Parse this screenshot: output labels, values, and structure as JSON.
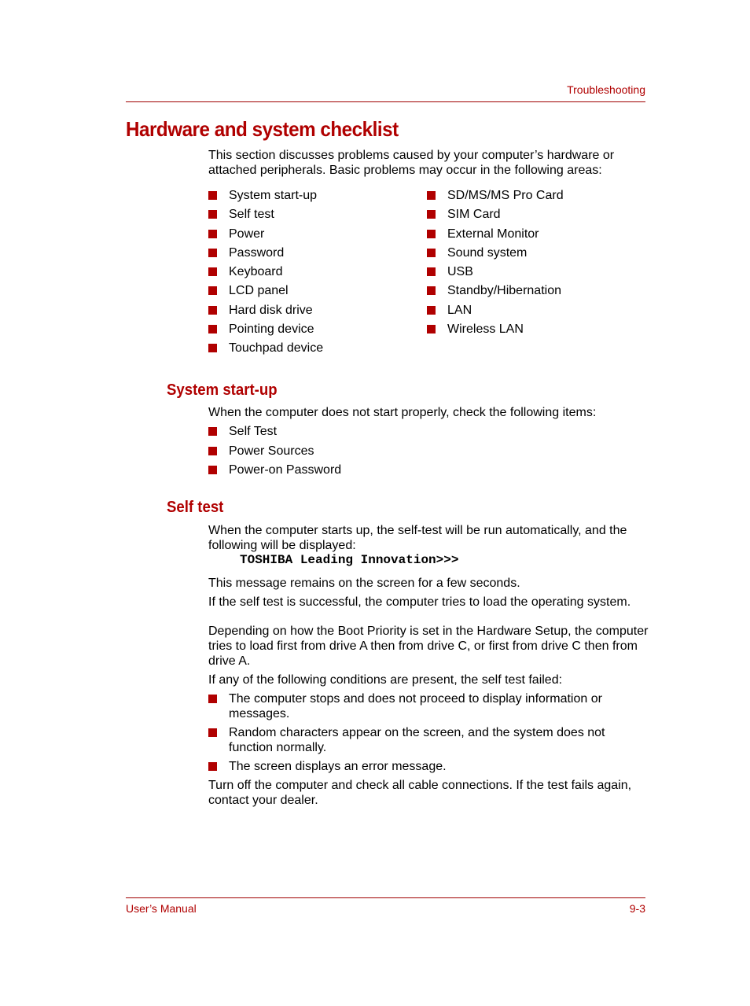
{
  "header": {
    "section": "Troubleshooting"
  },
  "title": "Hardware and system checklist",
  "intro": "This section discusses problems caused by your computer’s hardware or attached peripherals. Basic problems may occur in the following areas:",
  "areas": {
    "left": [
      "System start-up",
      "Self test",
      "Power",
      "Password",
      "Keyboard",
      "LCD panel",
      "Hard disk drive",
      "Pointing device",
      "Touchpad device"
    ],
    "right": [
      "SD/MS/MS Pro Card",
      "SIM Card",
      "External Monitor",
      "Sound system",
      "USB",
      "Standby/Hibernation",
      "LAN",
      "Wireless LAN"
    ]
  },
  "system_startup": {
    "heading": "System start-up",
    "text": "When the computer does not start properly, check the following items:",
    "items": [
      "Self Test",
      "Power Sources",
      "Power-on Password"
    ]
  },
  "self_test": {
    "heading": "Self test",
    "text": "When the computer starts up, the self-test will be run automatically, and the following will be displayed:",
    "message": "TOSHIBA Leading Innovation>>>",
    "remain": "This message remains on the screen for a few seconds.",
    "success": "If the self test is successful, the computer tries to load the operating system.",
    "boot": "Depending on how the Boot Priority is set in the Hardware Setup, the computer tries to load first from drive A then from drive C, or first from drive C then from drive A.",
    "conditions_intro": "If any of the following conditions are present, the self test failed:",
    "conditions": [
      "The computer stops and does not proceed to display information or messages.",
      "Random characters appear on the screen, and the system does not function normally.",
      "The screen displays an error message."
    ],
    "action": "Turn off the computer and check all cable connections. If the test fails again, contact your dealer."
  },
  "footer": {
    "left": "User’s Manual",
    "right": "9-3"
  }
}
